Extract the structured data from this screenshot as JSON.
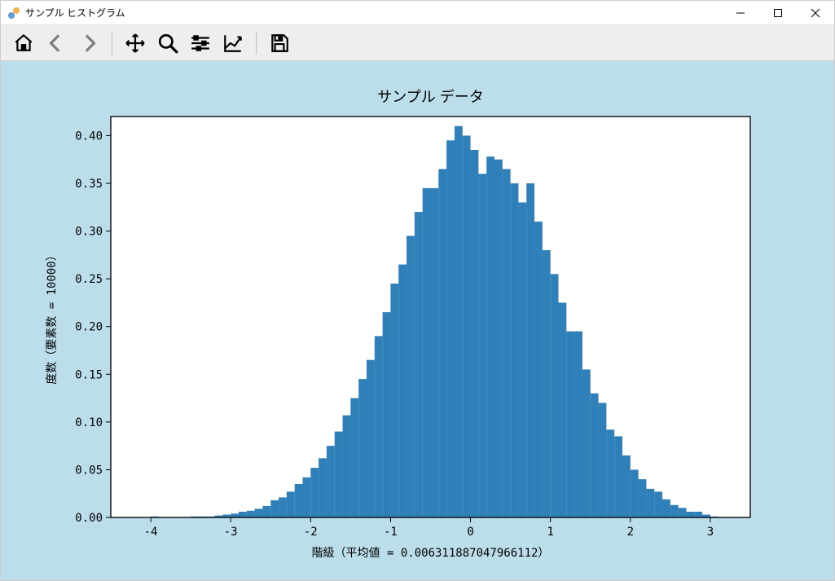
{
  "window": {
    "title": "サンプル ヒストグラム"
  },
  "toolbar": {
    "items": [
      "home",
      "back",
      "forward",
      "sep",
      "pan",
      "zoom",
      "configure",
      "axes",
      "sep",
      "save"
    ]
  },
  "chart_data": {
    "type": "bar",
    "title": "サンプル データ",
    "xlabel": "階級（平均値 = 0.006311887047966112）",
    "ylabel": "度数（要素数 = 10000）",
    "xlim": [
      -4.5,
      3.5
    ],
    "ylim": [
      0,
      0.42
    ],
    "xticks": [
      -4,
      -3,
      -2,
      -1,
      0,
      1,
      2,
      3
    ],
    "yticks": [
      0.0,
      0.05,
      0.1,
      0.15,
      0.2,
      0.25,
      0.3,
      0.35,
      0.4
    ],
    "bar_color": "#2F7FB8",
    "background": "#BCDEEB",
    "bin_width": 0.1,
    "categories": [
      -4.0,
      -3.9,
      -3.8,
      -3.7,
      -3.6,
      -3.5,
      -3.4,
      -3.3,
      -3.2,
      -3.1,
      -3.0,
      -2.9,
      -2.8,
      -2.7,
      -2.6,
      -2.5,
      -2.4,
      -2.3,
      -2.2,
      -2.1,
      -2.0,
      -1.9,
      -1.8,
      -1.7,
      -1.6,
      -1.5,
      -1.4,
      -1.3,
      -1.2,
      -1.1,
      -1.0,
      -0.9,
      -0.8,
      -0.7,
      -0.6,
      -0.5,
      -0.4,
      -0.3,
      -0.2,
      -0.1,
      0.0,
      0.1,
      0.2,
      0.3,
      0.4,
      0.5,
      0.6,
      0.7,
      0.8,
      0.9,
      1.0,
      1.1,
      1.2,
      1.3,
      1.4,
      1.5,
      1.6,
      1.7,
      1.8,
      1.9,
      2.0,
      2.1,
      2.2,
      2.3,
      2.4,
      2.5,
      2.6,
      2.7,
      2.8,
      2.9,
      3.0
    ],
    "values": [
      0.001,
      0.0,
      0.0,
      0.0,
      0.0,
      0.001,
      0.001,
      0.001,
      0.002,
      0.003,
      0.004,
      0.006,
      0.007,
      0.009,
      0.012,
      0.018,
      0.021,
      0.027,
      0.035,
      0.042,
      0.052,
      0.062,
      0.075,
      0.09,
      0.107,
      0.125,
      0.145,
      0.165,
      0.19,
      0.215,
      0.245,
      0.265,
      0.295,
      0.32,
      0.345,
      0.345,
      0.365,
      0.395,
      0.41,
      0.4,
      0.385,
      0.36,
      0.378,
      0.375,
      0.365,
      0.35,
      0.33,
      0.35,
      0.31,
      0.28,
      0.255,
      0.225,
      0.195,
      0.195,
      0.155,
      0.13,
      0.12,
      0.092,
      0.085,
      0.065,
      0.05,
      0.04,
      0.03,
      0.027,
      0.019,
      0.013,
      0.01,
      0.006,
      0.006,
      0.003,
      0.001
    ]
  }
}
